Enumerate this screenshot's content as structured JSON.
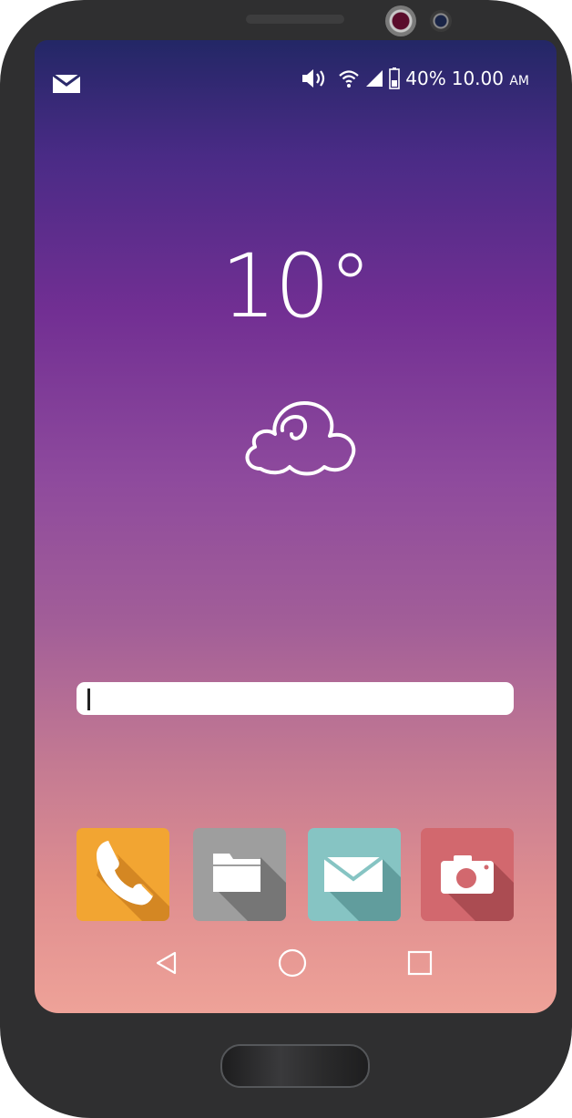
{
  "status_bar": {
    "battery": "40%",
    "time": "10.00",
    "ampm": "AM",
    "icons": [
      "mail-icon",
      "volume-icon",
      "wifi-icon",
      "signal-icon",
      "battery-icon"
    ]
  },
  "weather": {
    "temperature": "10°",
    "condition_icon": "cloud-icon"
  },
  "search": {
    "value": "",
    "placeholder": ""
  },
  "dock": {
    "apps": [
      {
        "name": "phone",
        "icon": "phone-icon",
        "color": "#f2a532"
      },
      {
        "name": "files",
        "icon": "folder-icon",
        "color": "#9e9e9e"
      },
      {
        "name": "messages",
        "icon": "envelope-icon",
        "color": "#86c4c3"
      },
      {
        "name": "camera",
        "icon": "camera-icon",
        "color": "#d2686e"
      }
    ]
  },
  "nav_bar": {
    "buttons": [
      "back-icon",
      "home-icon",
      "recents-icon"
    ]
  },
  "colors": {
    "bezel": "#2f2f30",
    "screen_top": "#232766",
    "screen_bottom": "#eea298"
  }
}
